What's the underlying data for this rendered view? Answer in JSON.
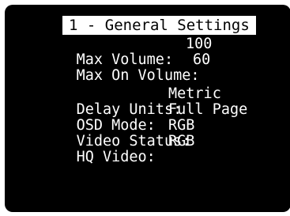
{
  "menu": {
    "title": "1 - General Settings",
    "items": [
      {
        "label": "Max Volume:",
        "value": "100"
      },
      {
        "label": "Max On Volume:",
        "value": "60"
      },
      {
        "label": "Delay Units:",
        "value": "Metric"
      },
      {
        "label": "OSD Mode:",
        "value": "Full Page"
      },
      {
        "label": "Video Status:",
        "value": "RGB"
      },
      {
        "label": "HQ Video:",
        "value": "RGB"
      }
    ]
  }
}
